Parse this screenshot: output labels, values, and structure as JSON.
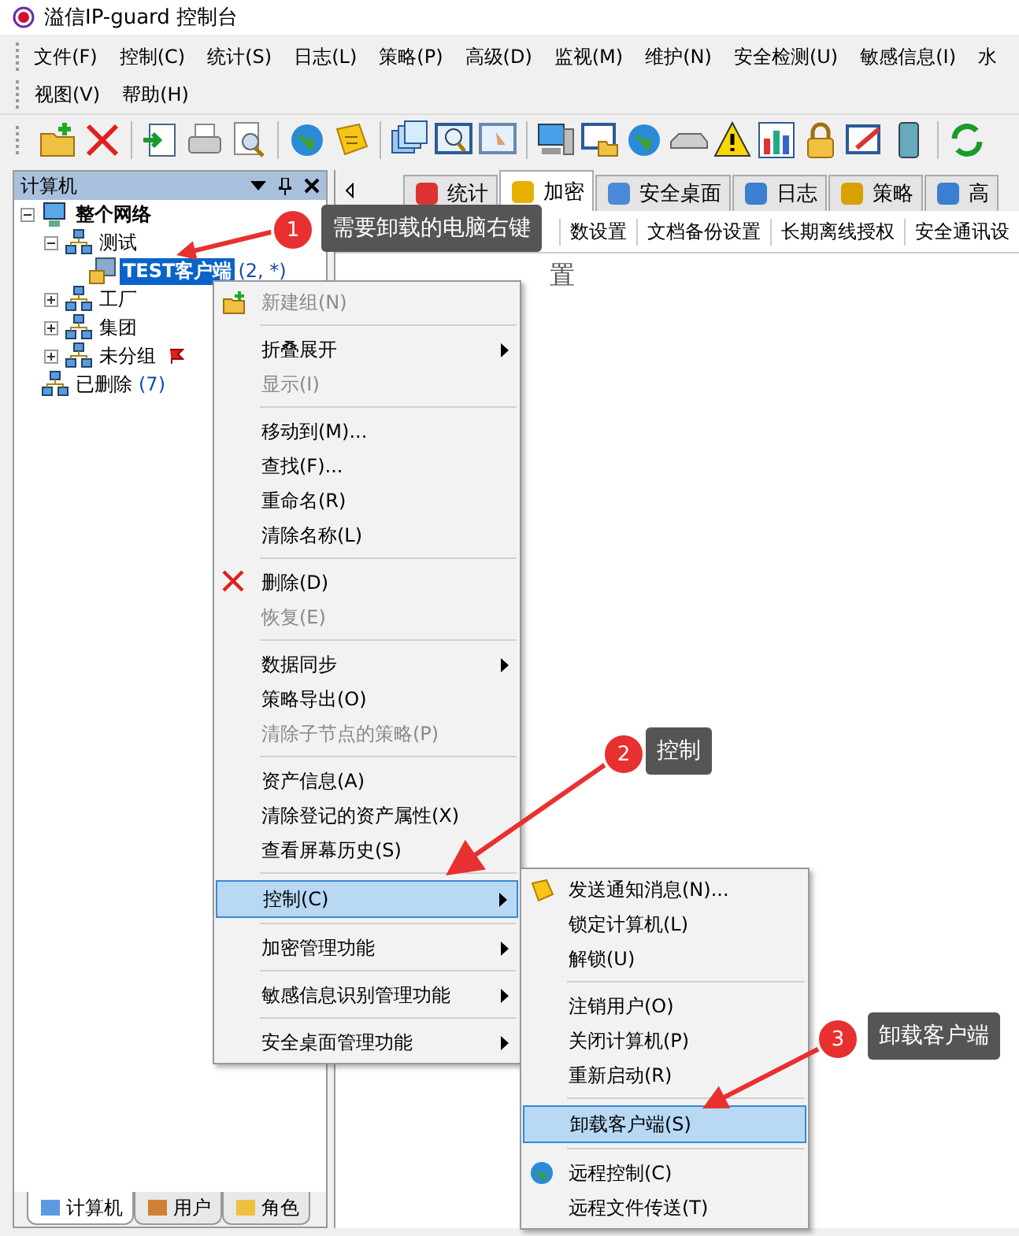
{
  "window": {
    "title": "溢信IP-guard 控制台"
  },
  "menu_bar": {
    "rows": [
      [
        "文件(F)",
        "控制(C)",
        "统计(S)",
        "日志(L)",
        "策略(P)",
        "高级(D)",
        "监视(M)",
        "维护(N)",
        "安全检测(U)",
        "敏感信息(I)",
        "水"
      ],
      [
        "视图(V)",
        "帮助(H)"
      ]
    ]
  },
  "left_panel": {
    "title": "计算机",
    "tree": [
      {
        "label": "整个网络",
        "bold": true,
        "expanded": true,
        "selected": false,
        "children": [
          {
            "label": "测试",
            "expanded": true,
            "selected": false,
            "children": [
              {
                "label": "TEST客户端",
                "count": "(2, *)",
                "selected": true
              }
            ]
          },
          {
            "label": "工厂",
            "expanded": false,
            "selected": false
          },
          {
            "label": "集团",
            "expanded": false,
            "selected": false
          },
          {
            "label": "未分组",
            "expanded": false,
            "selected": false,
            "flag": true
          }
        ]
      },
      {
        "label": "已删除",
        "count": "(7)",
        "selected": false
      }
    ],
    "bottom_tabs": [
      {
        "label": "计算机",
        "selected": true
      },
      {
        "label": "用户",
        "selected": false
      },
      {
        "label": "角色",
        "selected": false
      }
    ]
  },
  "main_tabs": [
    {
      "label": "统计",
      "selected": false
    },
    {
      "label": "加密",
      "selected": true
    },
    {
      "label": "安全桌面",
      "selected": false
    },
    {
      "label": "日志",
      "selected": false
    },
    {
      "label": "策略",
      "selected": false
    },
    {
      "label": "高",
      "selected": false
    }
  ],
  "sub_tabs": [
    "数设置",
    "文档备份设置",
    "长期离线授权",
    "安全通讯设"
  ],
  "content_heading": "置",
  "context_menu": [
    {
      "kind": "item",
      "label": "新建组(N)",
      "disabled": true
    },
    {
      "kind": "separator"
    },
    {
      "kind": "item",
      "label": "折叠展开",
      "submenu": true
    },
    {
      "kind": "item",
      "label": "显示(I)",
      "disabled": true
    },
    {
      "kind": "separator"
    },
    {
      "kind": "item",
      "label": "移动到(M)..."
    },
    {
      "kind": "item",
      "label": "查找(F)..."
    },
    {
      "kind": "item",
      "label": "重命名(R)"
    },
    {
      "kind": "item",
      "label": "清除名称(L)"
    },
    {
      "kind": "separator"
    },
    {
      "kind": "item",
      "label": "删除(D)"
    },
    {
      "kind": "item",
      "label": "恢复(E)",
      "disabled": true
    },
    {
      "kind": "separator"
    },
    {
      "kind": "item",
      "label": "数据同步",
      "submenu": true
    },
    {
      "kind": "item",
      "label": "策略导出(O)"
    },
    {
      "kind": "item",
      "label": "清除子节点的策略(P)",
      "disabled": true
    },
    {
      "kind": "separator"
    },
    {
      "kind": "item",
      "label": "资产信息(A)"
    },
    {
      "kind": "item",
      "label": "清除登记的资产属性(X)"
    },
    {
      "kind": "item",
      "label": "查看屏幕历史(S)"
    },
    {
      "kind": "separator"
    },
    {
      "kind": "item",
      "label": "控制(C)",
      "submenu": true,
      "selected": true
    },
    {
      "kind": "separator"
    },
    {
      "kind": "item",
      "label": "加密管理功能",
      "submenu": true
    },
    {
      "kind": "separator"
    },
    {
      "kind": "item",
      "label": "敏感信息识别管理功能",
      "submenu": true
    },
    {
      "kind": "separator"
    },
    {
      "kind": "item",
      "label": "安全桌面管理功能",
      "submenu": true
    }
  ],
  "sub_menu": [
    {
      "kind": "item",
      "label": "发送通知消息(N)..."
    },
    {
      "kind": "item",
      "label": "锁定计算机(L)"
    },
    {
      "kind": "item",
      "label": "解锁(U)"
    },
    {
      "kind": "separator"
    },
    {
      "kind": "item",
      "label": "注销用户(O)"
    },
    {
      "kind": "item",
      "label": "关闭计算机(P)"
    },
    {
      "kind": "item",
      "label": "重新启动(R)"
    },
    {
      "kind": "separator"
    },
    {
      "kind": "item",
      "label": "卸载客户端(S)",
      "selected": true
    },
    {
      "kind": "separator"
    },
    {
      "kind": "item",
      "label": "远程控制(C)"
    },
    {
      "kind": "item",
      "label": "远程文件传送(T)"
    }
  ],
  "annotations": [
    {
      "number": "1",
      "text": "需要卸载的电脑右键"
    },
    {
      "number": "2",
      "text": "控制"
    },
    {
      "number": "3",
      "text": "卸载客户端"
    }
  ]
}
